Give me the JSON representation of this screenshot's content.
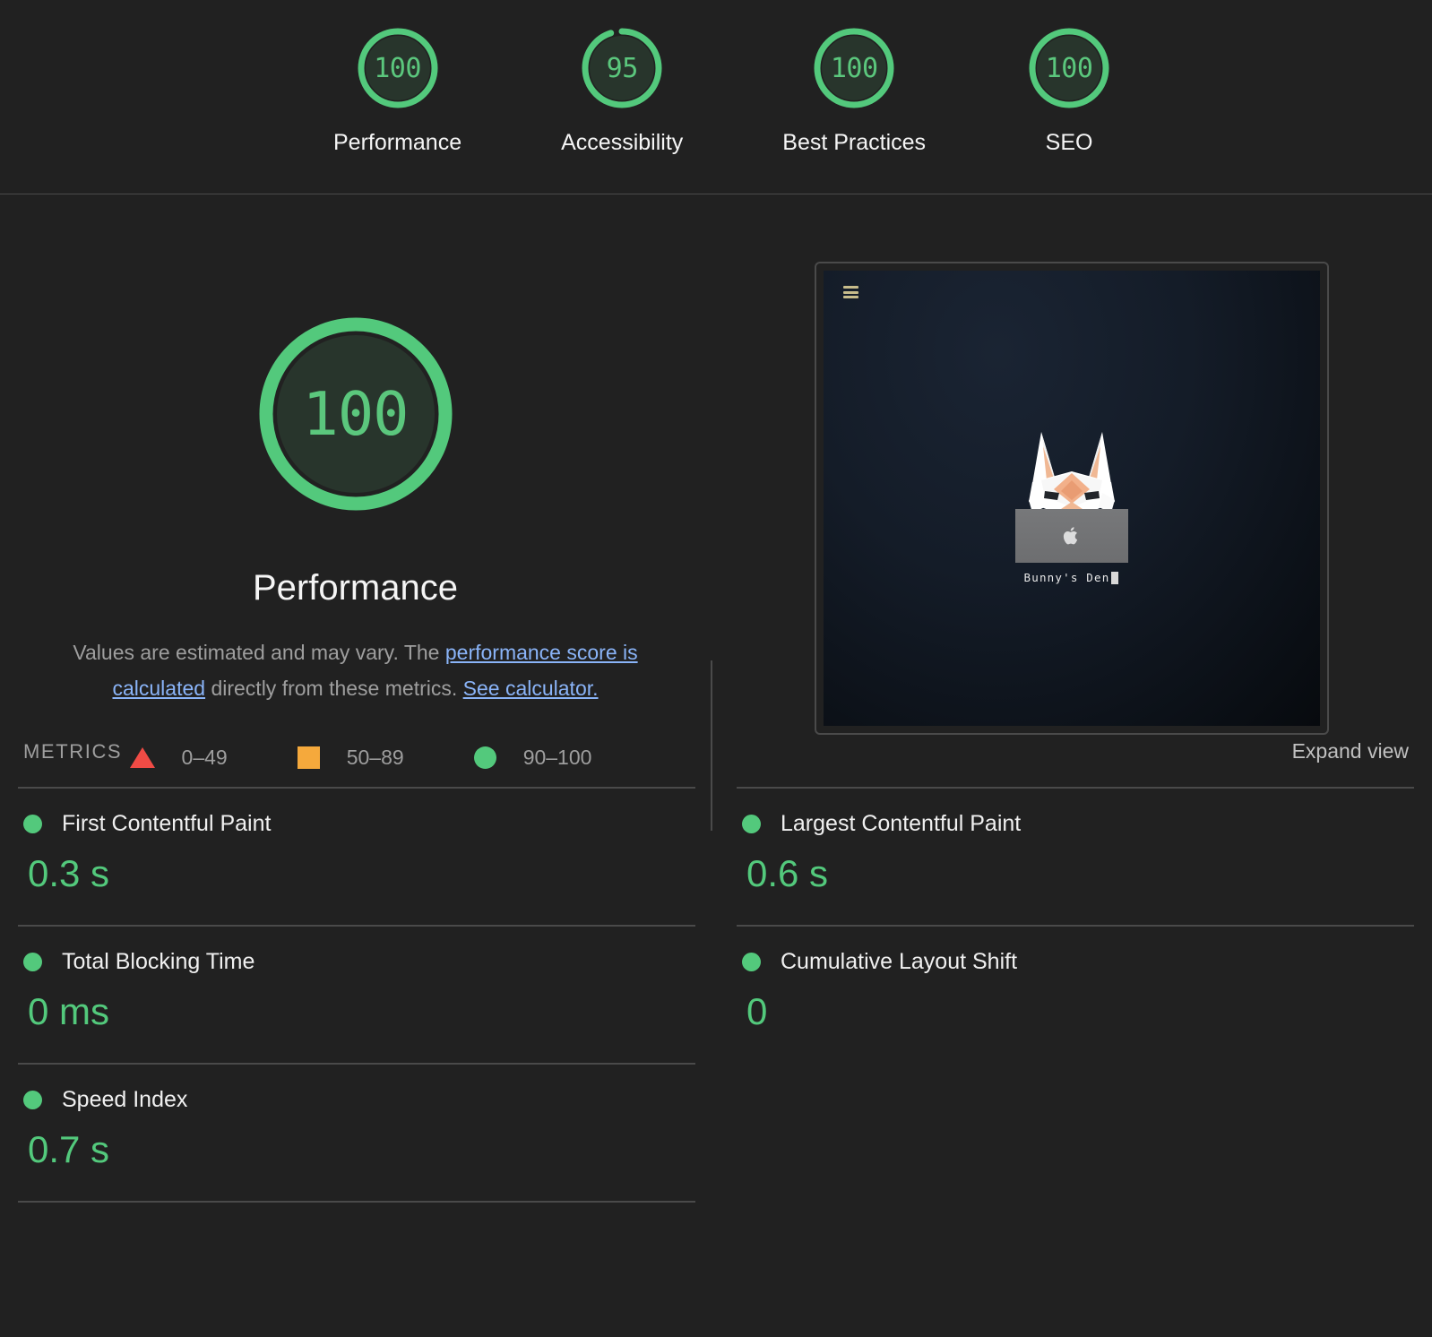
{
  "theme": {
    "background": "#212121",
    "divider": "#4a4a4a",
    "pass_green": "#53c97c",
    "average_orange": "#f5a93c",
    "fail_red": "#f04b45",
    "link_blue": "#8ab4f8",
    "text_primary": "#f5f5f5",
    "text_secondary": "#9e9e9e"
  },
  "topbar": {
    "gauges": [
      {
        "score": "100",
        "label": "Performance",
        "percent": 100
      },
      {
        "score": "95",
        "label": "Accessibility",
        "percent": 95
      },
      {
        "score": "100",
        "label": "Best Practices",
        "percent": 100
      },
      {
        "score": "100",
        "label": "SEO",
        "percent": 100
      }
    ]
  },
  "hero": {
    "score": "100",
    "score_percent": 100,
    "title": "Performance",
    "description": {
      "part1": "Values are estimated and may vary. The ",
      "link1": "performance score is calculated",
      "part2": " directly from these metrics. ",
      "link2": "See calculator."
    },
    "legend": [
      {
        "marker": "triangle-icon",
        "range": "0–49"
      },
      {
        "marker": "square-icon",
        "range": "50–89"
      },
      {
        "marker": "circle-icon",
        "range": "90–100"
      }
    ]
  },
  "thumbnail": {
    "menu_icon": "hamburger-menu-icon",
    "brand_icon": "apple-logo-icon",
    "mascot_icon": "low-poly-rabbit-icon",
    "caption": "Bunny's Den"
  },
  "metrics_section": {
    "title": "METRICS",
    "expand_label": "Expand view",
    "items": [
      {
        "name": "First Contentful Paint",
        "value": "0.3 s",
        "status": "pass"
      },
      {
        "name": "Largest Contentful Paint",
        "value": "0.6 s",
        "status": "pass"
      },
      {
        "name": "Total Blocking Time",
        "value": "0 ms",
        "status": "pass"
      },
      {
        "name": "Cumulative Layout Shift",
        "value": "0",
        "status": "pass"
      },
      {
        "name": "Speed Index",
        "value": "0.7 s",
        "status": "pass"
      }
    ]
  }
}
